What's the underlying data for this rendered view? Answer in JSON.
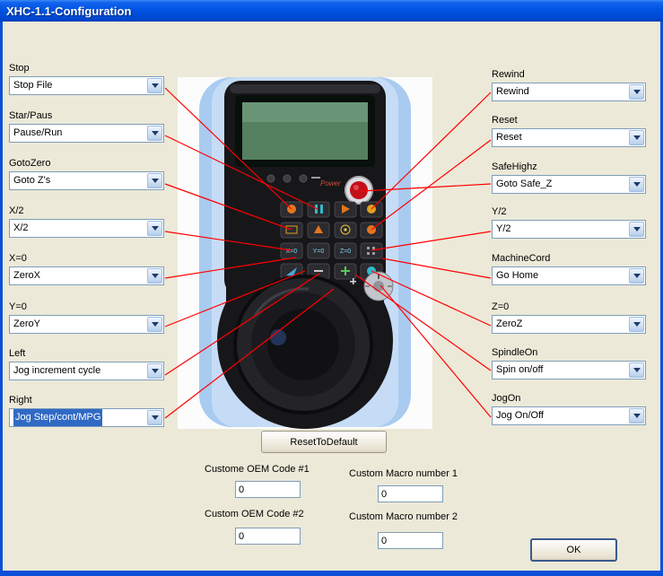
{
  "window": {
    "title": "XHC-1.1-Configuration"
  },
  "left_fields": [
    {
      "label": "Stop",
      "value": "Stop File"
    },
    {
      "label": "Star/Paus",
      "value": "Pause/Run"
    },
    {
      "label": "GotoZero",
      "value": "Goto Z's"
    },
    {
      "label": "X/2",
      "value": "X/2"
    },
    {
      "label": "X=0",
      "value": "ZeroX"
    },
    {
      "label": "Y=0",
      "value": "ZeroY"
    },
    {
      "label": "Left",
      "value": "Jog increment cycle"
    },
    {
      "label": "Right",
      "value": "Jog Step/cont/MPG"
    }
  ],
  "right_fields": [
    {
      "label": "Rewind",
      "value": "Rewind"
    },
    {
      "label": "Reset",
      "value": "Reset"
    },
    {
      "label": "SafeHighz",
      "value": "Goto Safe_Z"
    },
    {
      "label": "Y/2",
      "value": "Y/2"
    },
    {
      "label": "MachineCord",
      "value": "Go Home"
    },
    {
      "label": "Z=0",
      "value": "ZeroZ"
    },
    {
      "label": "SpindleOn",
      "value": "Spin on/off"
    },
    {
      "label": "JogOn",
      "value": "Jog On/Off"
    }
  ],
  "buttons": {
    "reset_to_default": "ResetToDefault",
    "ok": "OK"
  },
  "oem_fields": [
    {
      "label": "Custome OEM Code #1",
      "value": "0"
    },
    {
      "label": "Custom OEM Code #2",
      "value": "0"
    }
  ],
  "macro_fields": [
    {
      "label": "Custom Macro number 1",
      "value": "0"
    },
    {
      "label": "Custom Macro number 2",
      "value": "0"
    }
  ],
  "device": {
    "brand": "XHC",
    "power_label": "Power",
    "key_labels": [
      "X=0",
      "Y=0",
      "Z=0"
    ]
  },
  "colors": {
    "titlebar_blue": "#0054E3",
    "selection_blue": "#316AC5",
    "annotation_red": "#FF0000",
    "dialog_face": "#ECE9D8"
  }
}
